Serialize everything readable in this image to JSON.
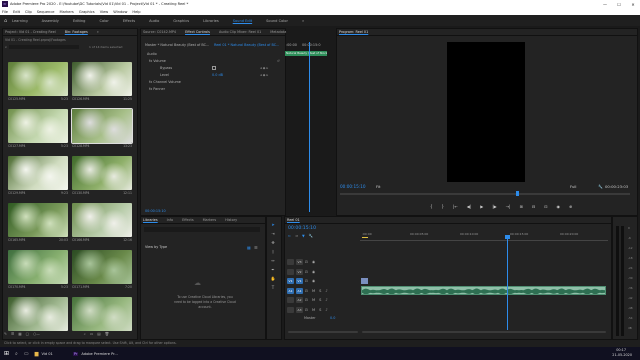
{
  "window": {
    "title": "Adobe Premiere Pro 2020 - E:\\Youtube\\DC Tutorials\\Vid 01\\Vid 01 - Project\\Vid 01 * - Creating Reel *",
    "minimize": "—",
    "maximize": "☐",
    "close": "✕"
  },
  "menu": [
    "File",
    "Edit",
    "Clip",
    "Sequence",
    "Markers",
    "Graphics",
    "View",
    "Window",
    "Help"
  ],
  "workspaces": {
    "items": [
      "Learning",
      "Assembly",
      "Editing",
      "Color",
      "Effects",
      "Audio",
      "Graphics",
      "Libraries",
      "Sound Edit",
      "Sound Color"
    ],
    "active_index": 8,
    "more": "»"
  },
  "project_panel": {
    "tabs": [
      "Project: Vid 01 - Creating Reel",
      "Bin: Footages"
    ],
    "more": "»",
    "path": "Vid 01 - Creating Reel.prproj\\Footages",
    "selection_info": "1 of 14 items selected",
    "clips": [
      {
        "name": "C0125.MP4",
        "duration": "5:23"
      },
      {
        "name": "C0126.MP4",
        "duration": "11:25"
      },
      {
        "name": "C0127.MP4",
        "duration": "5:23"
      },
      {
        "name": "C0128.MP4",
        "duration": "13:23"
      },
      {
        "name": "C0129.MP4",
        "duration": "9:23"
      },
      {
        "name": "C0130.MP4",
        "duration": "12:11"
      },
      {
        "name": "C0165.MP4",
        "duration": "20:03"
      },
      {
        "name": "C0166.MP4",
        "duration": "12:16"
      },
      {
        "name": "C0170.MP4",
        "duration": "5:23"
      },
      {
        "name": "C0171.MP4",
        "duration": "7:20"
      },
      {
        "name": "",
        "duration": ""
      },
      {
        "name": "",
        "duration": ""
      }
    ]
  },
  "effect_controls": {
    "tabs": [
      "Source: C0142.MP4",
      "Effect Controls",
      "Audio Clip Mixer: Reel 01",
      "Metadata"
    ],
    "active_tab": 1,
    "master_label": "Master * Natural Beauty (Best of BC...",
    "clip_label": "Reel 01 * Natural Beauty (Best of BC...",
    "timecode_start": ":00:00",
    "timecode_end": "00:00:15:0",
    "clip_bar_label": "Natural Beauty (Best of Stock",
    "rows": [
      {
        "label": "Audio",
        "value": ""
      },
      {
        "label": "fx  Volume",
        "value": ""
      },
      {
        "label": "Bypass",
        "value": ""
      },
      {
        "label": "Level",
        "value": "0.0 dB"
      },
      {
        "label": "fx  Channel Volume",
        "value": ""
      },
      {
        "label": "fx  Panner",
        "value": ""
      }
    ],
    "bottom_timecode": "00:00:15:10"
  },
  "program_monitor": {
    "title": "Program: Reel 01",
    "current_tc": "00:00:15:10",
    "fit": "Fit",
    "quality": "Full",
    "duration_tc": "00:00:23:03",
    "controls": [
      "{",
      "}",
      "|←",
      "◀|",
      "▶",
      "|▶",
      "→|",
      "⊞",
      "⊟",
      "⊡",
      "◉",
      "⊕"
    ]
  },
  "libraries_panel": {
    "tabs": [
      "Libraries",
      "Info",
      "Effects",
      "Markers",
      "History"
    ],
    "view_by": "View by Type",
    "message_line1": "To use Creative Cloud Libraries, you",
    "message_line2": "need to be logged into a Creative Cloud",
    "message_line3": "account."
  },
  "timeline": {
    "tab": "Reel 01",
    "timecode": "00:00:15:10",
    "ruler": [
      ":00:00",
      "00:00:05:00",
      "00:00:10:00",
      "00:00:15:00",
      "00:00:20:00"
    ],
    "video_tracks": [
      "V3",
      "V2",
      "V1"
    ],
    "audio_tracks": [
      "A1",
      "A2",
      "A3"
    ],
    "master_label": "Master",
    "master_value": "0.0"
  },
  "status": {
    "text": "Click to select, or click in empty space and drag to marquee select. Use Shift, Alt, and Ctrl for other options."
  },
  "taskbar": {
    "items": [
      "Vid 01",
      "Adobe Premiere Pr..."
    ],
    "time": "00:17",
    "date": "21-05-2020"
  },
  "meters": {
    "labels": [
      "0",
      "-6",
      "-12",
      "-18",
      "-24",
      "-30",
      "-36",
      "-42",
      "-48",
      "-54",
      "dB"
    ]
  }
}
